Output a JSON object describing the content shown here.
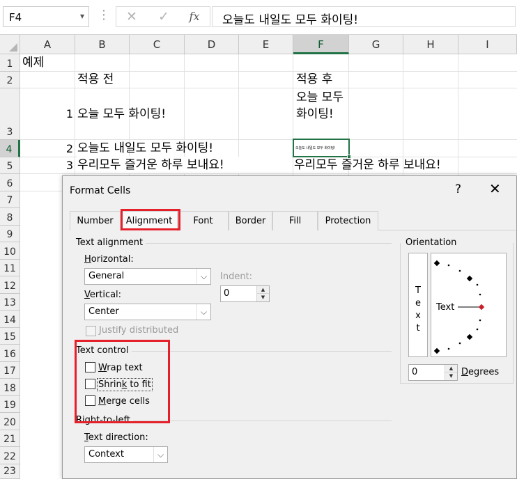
{
  "formula_bar": {
    "name_box": "F4",
    "name_box_arrow": "▾",
    "dots": "⋮",
    "cancel_icon": "✕",
    "enter_icon": "✓",
    "fx_label": "fx",
    "formula": "오늘도 내일도 모두 화이팅!"
  },
  "columns": [
    "A",
    "B",
    "C",
    "D",
    "E",
    "F",
    "G",
    "H",
    "I"
  ],
  "selected_column": "F",
  "rows": [
    "1",
    "2",
    "3",
    "4",
    "5",
    "6",
    "7",
    "8",
    "9",
    "10",
    "11",
    "12",
    "13",
    "14",
    "15",
    "16",
    "17",
    "18",
    "19",
    "20",
    "21",
    "22",
    "23"
  ],
  "selected_row": "4",
  "cells": {
    "a1": "예제",
    "b2": "적용 전",
    "f2": "적용 후",
    "a3": "1",
    "b3": "오늘 모두 화이팅!",
    "f3": "오늘 모두 화이팅!",
    "a4": "2",
    "b4": "오늘도 내일도 모두 화이팅!",
    "f4": "오늘도 내일도 모두 화이팅!",
    "a5": "3",
    "b5": "우리모두 즐거운 하루 보내요!",
    "f5": "우리모두 즐거운 하루 보내요!"
  },
  "dialog": {
    "title": "Format Cells",
    "help": "?",
    "close": "✕",
    "tabs": [
      "Number",
      "Alignment",
      "Font",
      "Border",
      "Fill",
      "Protection"
    ],
    "active_tab": "Alignment",
    "text_alignment": {
      "section": "Text alignment",
      "horizontal_label_ul": "H",
      "horizontal_label_rest": "orizontal:",
      "horizontal_value": "General",
      "indent_label": "Indent:",
      "indent_value": "0",
      "vertical_label_ul": "V",
      "vertical_label_rest": "ertical:",
      "vertical_value": "Center",
      "justify_label": "Justify distributed"
    },
    "text_control": {
      "section": "Text control",
      "wrap_ul": "W",
      "wrap_rest": "rap text",
      "wrap_checked": false,
      "shrink_pre": "Shrin",
      "shrink_ul": "k",
      "shrink_rest": " to fit",
      "shrink_checked": false,
      "merge_ul": "M",
      "merge_rest": "erge cells",
      "merge_checked": false
    },
    "right_to_left": {
      "section": "Right-to-left",
      "direction_label_ul": "T",
      "direction_label_rest": "ext direction:",
      "direction_value": "Context"
    },
    "orientation": {
      "section": "Orientation",
      "vertical_text": [
        "T",
        "e",
        "x",
        "t"
      ],
      "dial_label": "Text",
      "degrees_value": "0",
      "degrees_label_ul": "D",
      "degrees_label_rest": "egrees"
    }
  },
  "highlight_color": "#e5202a",
  "selection_color": "#217346"
}
